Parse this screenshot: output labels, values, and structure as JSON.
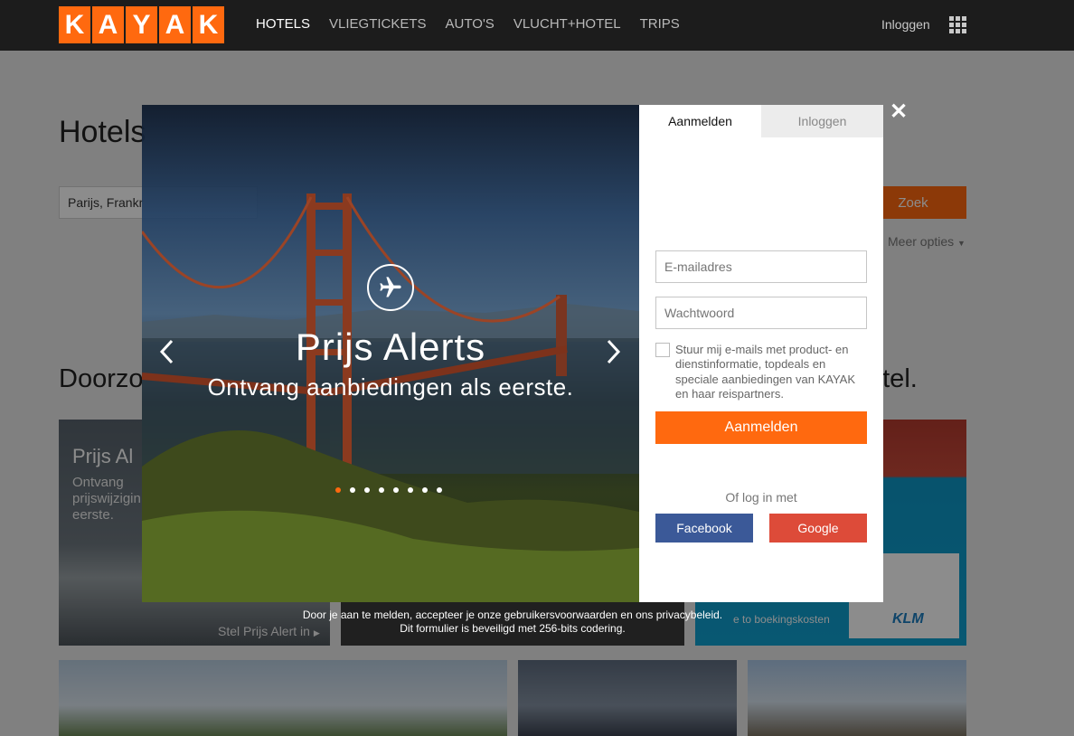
{
  "brand": {
    "letters": [
      "K",
      "A",
      "Y",
      "A",
      "K"
    ],
    "color": "#ff690f"
  },
  "nav": {
    "items": [
      "HOTELS",
      "VLIEGTICKETS",
      "AUTO'S",
      "VLUCHT+HOTEL",
      "TRIPS"
    ],
    "active": "HOTELS",
    "login": "Inloggen",
    "apps_icon": "grid-icon"
  },
  "page": {
    "title": "Hotels",
    "destination_value": "Parijs, Frankr",
    "search_button": "Zoek",
    "more_options": "Meer opties",
    "section_heading": "Doorzo",
    "section_heading_end": "otel.",
    "card_a": {
      "title": "Prijs Al",
      "text": "Ontvang prijswijzigin eerste.",
      "link": "Stel Prijs Alert in"
    },
    "card_c": {
      "text": "e to boekingskosten",
      "logo": "KLM"
    }
  },
  "modal": {
    "hero": {
      "icon": "airplane-icon",
      "title": "Prijs Alerts",
      "subtitle": "Ontvang aanbiedingen als eerste.",
      "dots": 8,
      "active_dot": 0
    },
    "tabs": {
      "signup": "Aanmelden",
      "login": "Inloggen",
      "active": "signup"
    },
    "email_placeholder": "E-mailadres",
    "password_placeholder": "Wachtwoord",
    "checkbox_label": "Stuur mij e-mails met product- en dienstinformatie, topdeals en speciale aanbiedingen van KAYAK en haar reispartners.",
    "signup_button": "Aanmelden",
    "or_login": "Of log in met",
    "facebook": "Facebook",
    "google": "Google",
    "close": "✕"
  },
  "footer": {
    "line1": "Door je aan te melden, accepteer je onze gebruikersvoorwaarden en ons privacybeleid.",
    "line2": "Dit formulier is beveiligd met 256-bits codering."
  },
  "colors": {
    "accent": "#ff690f",
    "facebook": "#3b5998",
    "google": "#dd4b39",
    "topbar": "#1c1c1c"
  }
}
